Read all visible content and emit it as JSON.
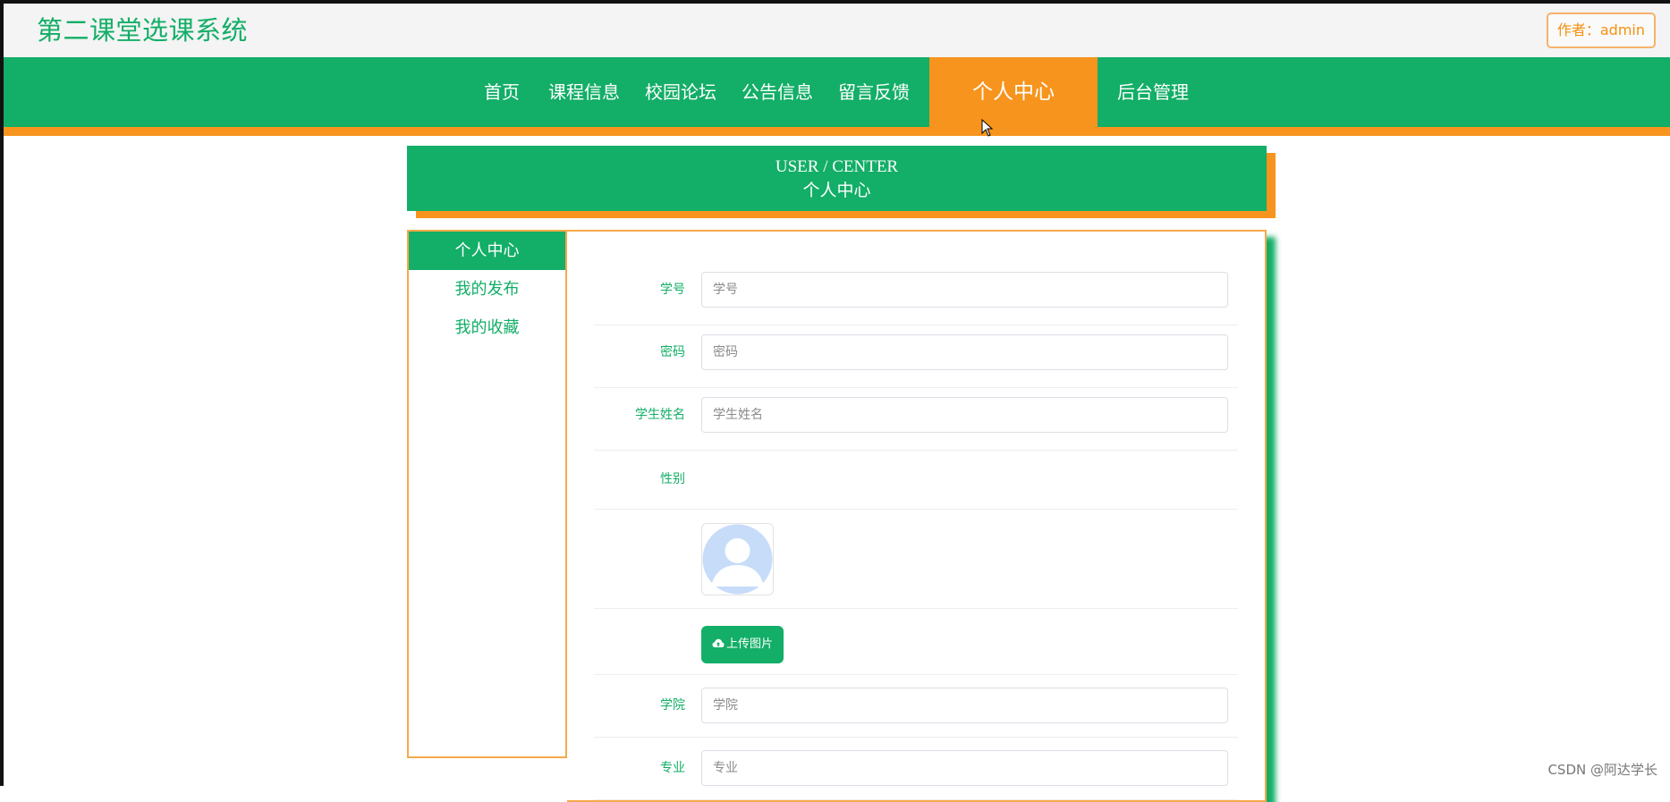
{
  "site": {
    "title": "第二课堂选课系统",
    "author_badge": "作者：admin"
  },
  "nav": {
    "items": [
      {
        "label": "首页"
      },
      {
        "label": "课程信息"
      },
      {
        "label": "校园论坛"
      },
      {
        "label": "公告信息"
      },
      {
        "label": "留言反馈"
      },
      {
        "label": "个人中心",
        "active": true
      },
      {
        "label": "后台管理"
      }
    ]
  },
  "hero": {
    "en": "USER / CENTER",
    "zh": "个人中心"
  },
  "side_menu": {
    "items": [
      {
        "label": "个人中心",
        "active": true
      },
      {
        "label": "我的发布"
      },
      {
        "label": "我的收藏"
      }
    ]
  },
  "form": {
    "student_id": {
      "label": "学号",
      "placeholder": "学号",
      "value": ""
    },
    "password": {
      "label": "密码",
      "placeholder": "密码",
      "value": ""
    },
    "student_name": {
      "label": "学生姓名",
      "placeholder": "学生姓名",
      "value": ""
    },
    "gender": {
      "label": "性别"
    },
    "avatar_icon": "user-avatar-placeholder-icon",
    "upload_label": "上传图片",
    "college": {
      "label": "学院",
      "placeholder": "学院",
      "value": ""
    },
    "major": {
      "label": "专业",
      "placeholder": "专业",
      "value": ""
    }
  },
  "watermark": "CSDN @阿达学长",
  "colors": {
    "primary_green": "#13ae67",
    "accent_orange": "#f7941d"
  }
}
